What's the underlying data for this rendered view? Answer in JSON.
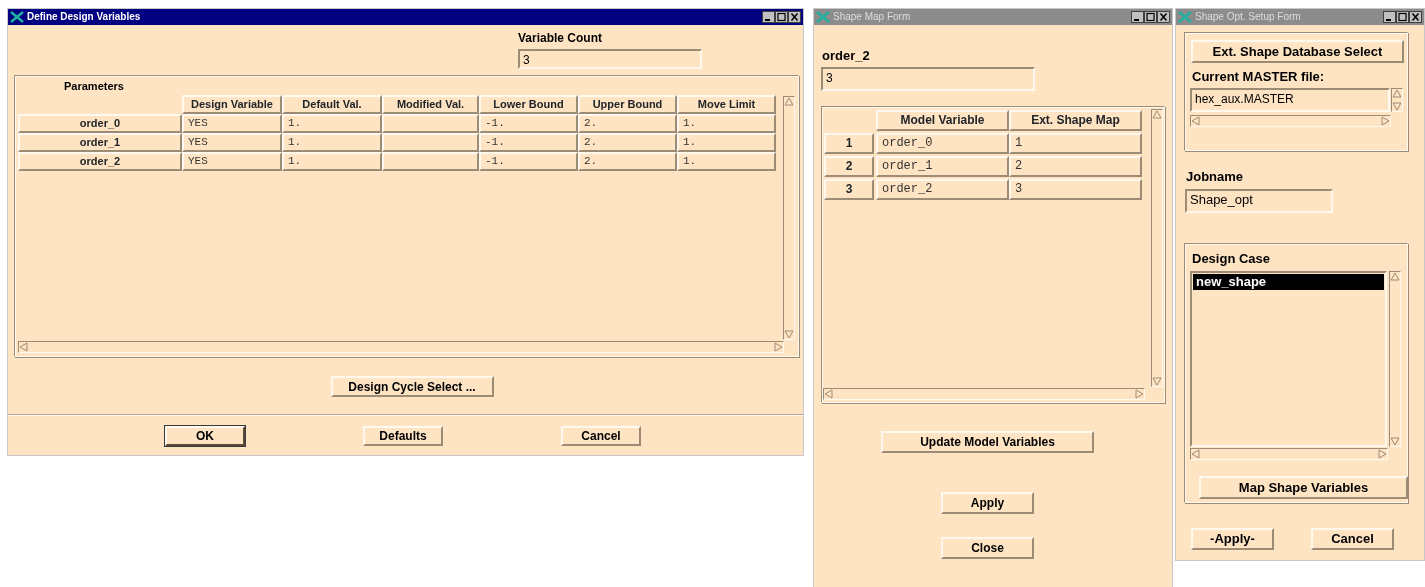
{
  "design_variables_window": {
    "title": "Define Design Variables",
    "active": true,
    "variable_count": {
      "label": "Variable Count",
      "value": "3"
    },
    "parameters": {
      "title": "Parameters",
      "columns": [
        "Design Variable",
        "Default Val.",
        "Modified Val.",
        "Lower Bound",
        "Upper Bound",
        "Move Limit"
      ],
      "rows": [
        {
          "header": "order_0",
          "cells": [
            "YES",
            "1.",
            null,
            "-1.",
            "2.",
            "1."
          ]
        },
        {
          "header": "order_1",
          "cells": [
            "YES",
            "1.",
            null,
            "-1.",
            "2.",
            "1."
          ]
        },
        {
          "header": "order_2",
          "cells": [
            "YES",
            "1.",
            null,
            "-1.",
            "2.",
            "1."
          ]
        }
      ]
    },
    "cycle_button": "Design Cycle Select ...",
    "buttons": [
      {
        "label": "OK",
        "default": true
      },
      {
        "label": "Defaults",
        "default": false
      },
      {
        "label": "Cancel",
        "default": false
      }
    ]
  },
  "shape_map_window": {
    "title": "Shape Map Form",
    "active": false,
    "field": {
      "label": "order_2",
      "value": "3"
    },
    "table": {
      "columns": [
        "Model Variable",
        "Ext. Shape Map"
      ],
      "rows": [
        {
          "number": "1",
          "model_variable": "order_0",
          "ext_shape_map": "1"
        },
        {
          "number": "2",
          "model_variable": "order_1",
          "ext_shape_map": "2"
        },
        {
          "number": "3",
          "model_variable": "order_2",
          "ext_shape_map": "3"
        }
      ]
    },
    "update_button": "Update Model Variables",
    "buttons": [
      "Apply",
      "Close"
    ]
  },
  "shape_opt_window": {
    "title": "Shape Opt. Setup Form",
    "active": false,
    "database_button": "Ext. Shape Database Select",
    "master_file": {
      "label": "Current MASTER file:",
      "value": "hex_aux.MASTER"
    },
    "jobname": {
      "label": "Jobname",
      "value": "Shape_opt"
    },
    "design_case": {
      "label": "Design Case",
      "items": [
        {
          "label": "new_shape",
          "selected": true
        }
      ]
    },
    "map_button": "Map Shape Variables",
    "buttons": [
      "-Apply-",
      "Cancel"
    ]
  }
}
